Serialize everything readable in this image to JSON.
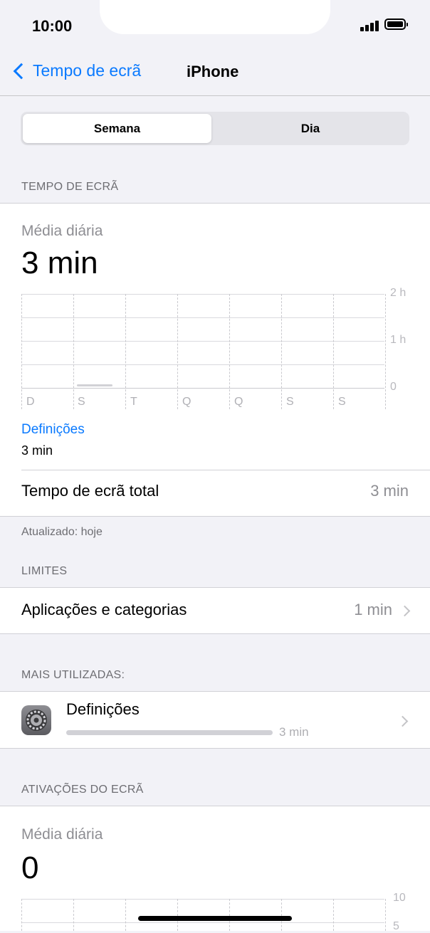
{
  "status": {
    "time": "10:00"
  },
  "nav": {
    "back_label": "Tempo de ecrã",
    "title": "iPhone"
  },
  "segment": {
    "options": [
      "Semana",
      "Dia"
    ],
    "selected": "Semana"
  },
  "screen_time": {
    "section": "TEMPO DE ECRÃ",
    "avg_label": "Média diária",
    "avg_value": "3 min",
    "chart_data": {
      "type": "bar",
      "categories": [
        "D",
        "S",
        "T",
        "Q",
        "Q",
        "S",
        "S"
      ],
      "values_min": [
        0,
        3,
        0,
        0,
        0,
        0,
        0
      ],
      "y_ticks": [
        "2 h",
        "1 h",
        "0"
      ],
      "ylim_hours": [
        0,
        2
      ]
    },
    "category_label": "Definições",
    "category_value": "3 min",
    "total_label": "Tempo de ecrã total",
    "total_value": "3 min",
    "updated": "Atualizado: hoje"
  },
  "limits": {
    "section": "LIMITES",
    "apps_label": "Aplicações e categorias",
    "apps_value": "1 min"
  },
  "most_used": {
    "section": "MAIS UTILIZADAS:",
    "items": [
      {
        "name": "Definições",
        "time": "3 min",
        "icon": "settings-gear-icon"
      }
    ]
  },
  "pickups": {
    "section": "ATIVAÇÕES DO ECRÃ",
    "avg_label": "Média diária",
    "avg_value": "0",
    "y_ticks": [
      "10",
      "5"
    ]
  },
  "colors": {
    "accent": "#0a7aff",
    "background": "#f2f2f7"
  }
}
